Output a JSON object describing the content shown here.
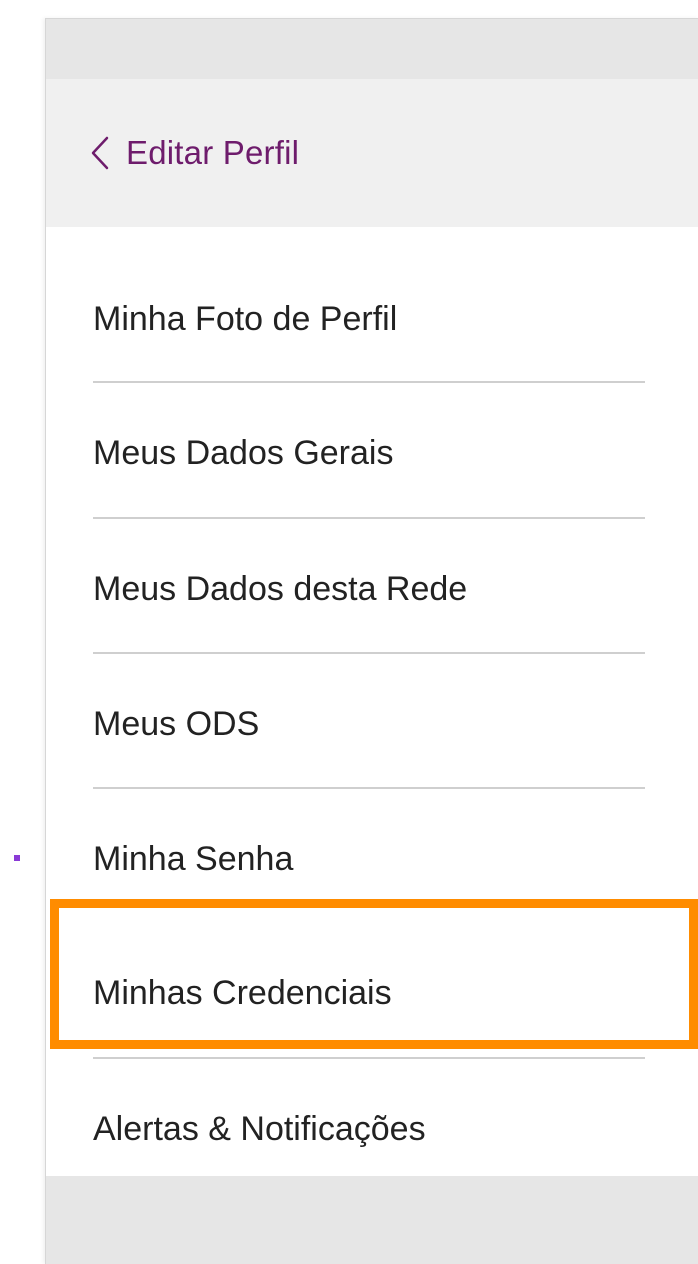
{
  "header": {
    "back_label": "Editar Perfil"
  },
  "menu": {
    "items": [
      {
        "label": "Minha Foto de Perfil"
      },
      {
        "label": "Meus Dados Gerais"
      },
      {
        "label": "Meus Dados desta Rede"
      },
      {
        "label": "Meus ODS"
      },
      {
        "label": "Minha Senha"
      },
      {
        "label": "Minhas Credenciais"
      },
      {
        "label": "Alertas & Notificações"
      }
    ],
    "highlighted_item": "Minhas Credenciais"
  },
  "colors": {
    "accent": "#6e1c6c",
    "highlight": "#ff8c00",
    "marker": "#8a3ad6"
  },
  "icons": {
    "back": "chevron-left-icon"
  }
}
